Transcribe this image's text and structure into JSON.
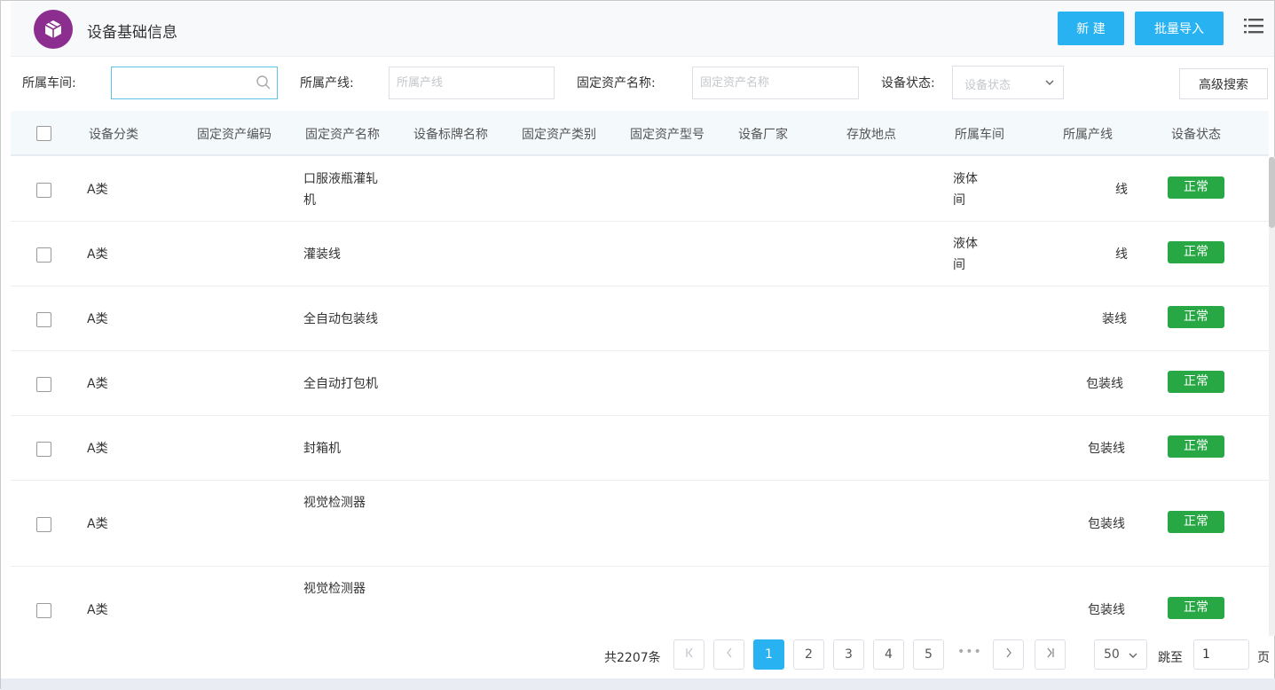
{
  "header": {
    "title": "设备基础信息",
    "new_label": "新 建",
    "import_label": "批量导入",
    "accent": "#29b2f2",
    "logo_color": "#8c2e8f"
  },
  "filters": {
    "workshop_label": "所属车间:",
    "workshop_value": "",
    "line_label": "所属产线:",
    "line_placeholder": "所属产线",
    "asset_name_label": "固定资产名称:",
    "asset_name_placeholder": "固定资产名称",
    "status_label": "设备状态:",
    "status_placeholder": "设备状态",
    "advanced_label": "高级搜索"
  },
  "table": {
    "columns": [
      "设备分类",
      "固定资产编码",
      "固定资产名称",
      "设备标牌名称",
      "固定资产类别",
      "固定资产型号",
      "设备厂家",
      "存放地点",
      "所属车间",
      "所属产线",
      "设备状态"
    ],
    "rows": [
      {
        "category": "A类",
        "name": "口服液瓶灌轧机",
        "workshop": "液体\n间",
        "line": "线",
        "status": "正常"
      },
      {
        "category": "A类",
        "name": "灌装线",
        "workshop": "液体\n间",
        "line": "线",
        "status": "正常"
      },
      {
        "category": "A类",
        "name": "全自动包装线",
        "workshop": "",
        "line": "装线",
        "status": "正常"
      },
      {
        "category": "A类",
        "name": "全自动打包机",
        "workshop": "",
        "line": "包装线",
        "status": "正常"
      },
      {
        "category": "A类",
        "name": "封箱机",
        "workshop": "",
        "line": "包装线",
        "status": "正常"
      },
      {
        "category": "A类",
        "name": "视觉检测器",
        "workshop": "",
        "line": "包装线",
        "status": "正常"
      },
      {
        "category": "A类",
        "name": "视觉检测器",
        "workshop": "",
        "line": "包装线",
        "status": "正常"
      }
    ],
    "status_color": "#28a745"
  },
  "pagination": {
    "total": "共2207条",
    "pages": [
      "1",
      "2",
      "3",
      "4",
      "5"
    ],
    "current": "1",
    "ellipsis": "•••",
    "page_size": "50",
    "jump_label": "跳至",
    "jump_value": "1",
    "page_unit": "页"
  }
}
